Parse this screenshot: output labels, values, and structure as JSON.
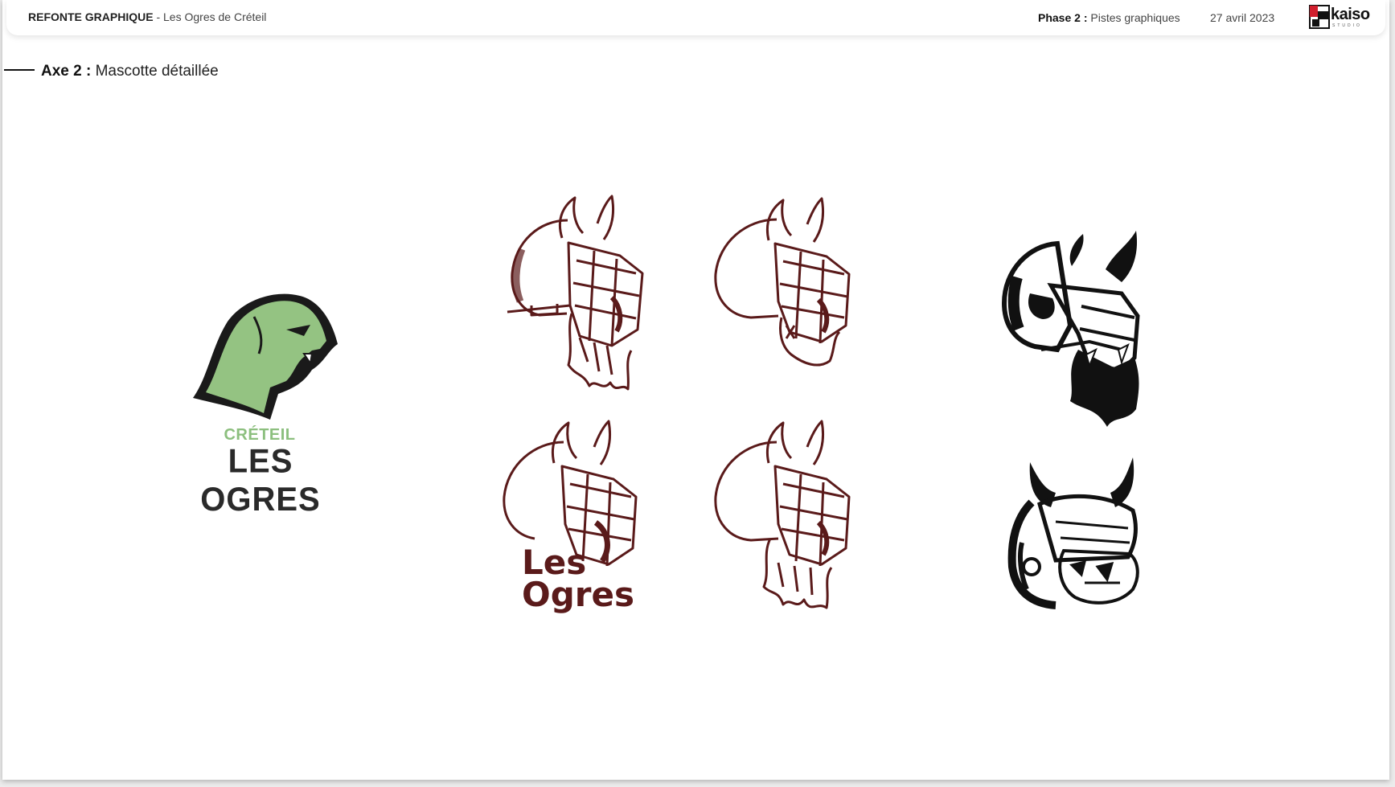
{
  "header": {
    "project_title": "REFONTE GRAPHIQUE",
    "project_sub": " - Les Ogres de Créteil",
    "phase_label": "Phase 2 :",
    "phase_value": " Pistes graphiques",
    "date": "27 avril 2023",
    "brand_name": "kaiso",
    "brand_sub": "STUDIO"
  },
  "section": {
    "label": "Axe 2 :",
    "title": " Mascotte détaillée"
  },
  "logo": {
    "top_text": "CRÉTEIL",
    "main_text": "LES OGRES"
  },
  "variants": {
    "wordmark_line1": "Les",
    "wordmark_line2": "Ogres"
  },
  "colors": {
    "green": "#8cbf7e",
    "maroon": "#5a1a1a",
    "ink": "#111111"
  }
}
